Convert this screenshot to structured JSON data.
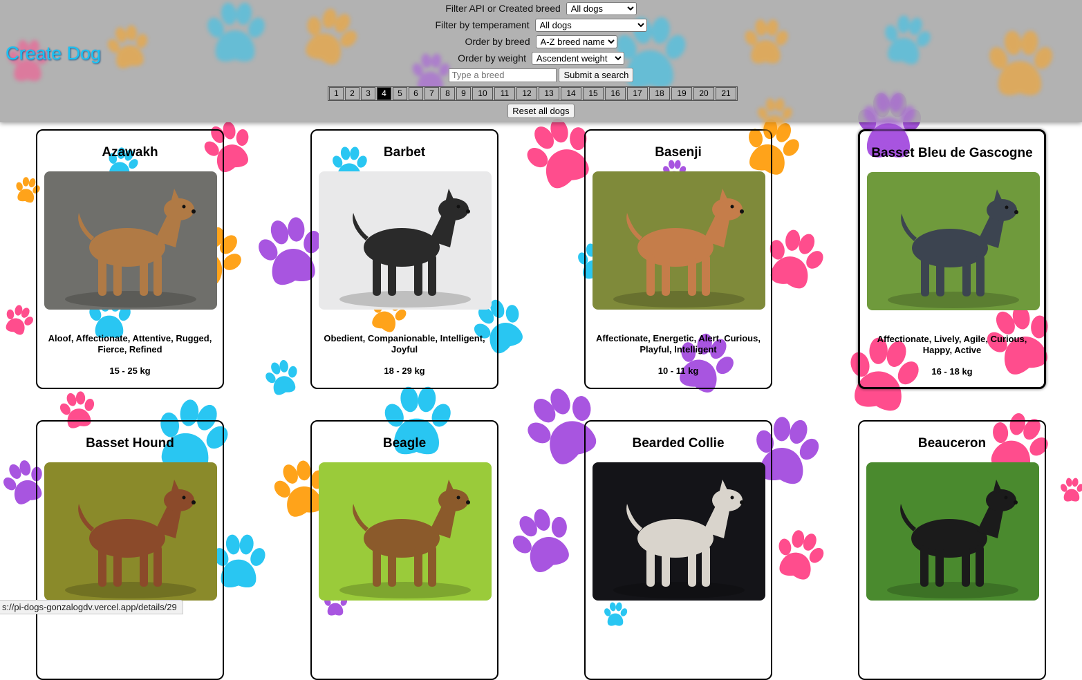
{
  "header": {
    "create_link": "Create Dog",
    "filter_api": {
      "label": "Filter API or Created breed",
      "selected": "All dogs"
    },
    "filter_temperament": {
      "label": "Filter by temperament",
      "selected": "All dogs"
    },
    "order_breed": {
      "label": "Order by breed",
      "selected": "A-Z breed name"
    },
    "order_weight": {
      "label": "Order by weight",
      "selected": "Ascendent weight"
    },
    "search": {
      "placeholder": "Type a breed",
      "button": "Submit a search"
    },
    "pagination": {
      "pages": [
        "1",
        "2",
        "3",
        "4",
        "5",
        "6",
        "7",
        "8",
        "9",
        "10",
        "11",
        "12",
        "13",
        "14",
        "15",
        "16",
        "17",
        "18",
        "19",
        "20",
        "21"
      ],
      "current": "4"
    },
    "reset_button": "Reset all dogs"
  },
  "cards": [
    {
      "name": "Azawakh",
      "temperament": "Aloof, Affectionate, Attentive, Rugged, Fierce, Refined",
      "weight": "15 - 25 kg",
      "colors": {
        "bg": "#6f6f6b",
        "dog": "#b07a45"
      }
    },
    {
      "name": "Barbet",
      "temperament": "Obedient, Companionable, Intelligent, Joyful",
      "weight": "18 - 29 kg",
      "colors": {
        "bg": "#e9e9ea",
        "dog": "#2a2a2a"
      }
    },
    {
      "name": "Basenji",
      "temperament": "Affectionate, Energetic, Alert, Curious, Playful, Intelligent",
      "weight": "10 - 11 kg",
      "colors": {
        "bg": "#7f8a3a",
        "dog": "#c57d4a"
      }
    },
    {
      "name": "Basset Bleu de Gascogne",
      "temperament": "Affectionate, Lively, Agile, Curious, Happy, Active",
      "weight": "16 - 18 kg",
      "colors": {
        "bg": "#6f9a3c",
        "dog": "#3c4450"
      }
    },
    {
      "name": "Basset Hound",
      "temperament": "",
      "weight": "",
      "colors": {
        "bg": "#8a8a2a",
        "dog": "#8b4a2a"
      }
    },
    {
      "name": "Beagle",
      "temperament": "",
      "weight": "",
      "colors": {
        "bg": "#9acb3a",
        "dog": "#8b5a2b"
      }
    },
    {
      "name": "Bearded Collie",
      "temperament": "",
      "weight": "",
      "colors": {
        "bg": "#141418",
        "dog": "#d9d4cc"
      }
    },
    {
      "name": "Beauceron",
      "temperament": "",
      "weight": "",
      "colors": {
        "bg": "#4a8a2e",
        "dog": "#1b1b1b"
      }
    }
  ],
  "status_bar": "s://pi-dogs-gonzalogdv.vercel.app/details/29",
  "paw_colors": [
    "#ff4d8d",
    "#a855e0",
    "#ffa31a",
    "#29c6f2"
  ]
}
